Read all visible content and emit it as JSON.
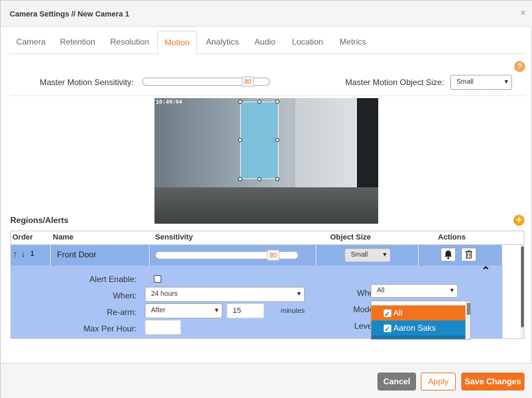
{
  "window": {
    "title": "Camera Settings // New Camera 1",
    "close_glyph": "×"
  },
  "tabs": [
    {
      "label": "Camera",
      "active": false
    },
    {
      "label": "Retention",
      "active": false
    },
    {
      "label": "Resolution",
      "active": false
    },
    {
      "label": "Motion",
      "active": true
    },
    {
      "label": "Analytics",
      "active": false
    },
    {
      "label": "Audio",
      "active": false
    },
    {
      "label": "Location",
      "active": false
    },
    {
      "label": "Metrics",
      "active": false
    }
  ],
  "help_glyph": "?",
  "master": {
    "sensitivity_label": "Master Motion Sensitivity:",
    "sensitivity_value": "80",
    "object_size_label": "Master Motion Object Size:",
    "object_size_value": "Small"
  },
  "preview": {
    "timestamp": "10:49:04"
  },
  "regions": {
    "title": "Regions/Alerts",
    "add_glyph": "+",
    "columns": [
      "Order",
      "Name",
      "Sensitivity",
      "Object Size",
      "Actions"
    ],
    "row": {
      "order_up": "↑",
      "order_down": "↓",
      "order": "1",
      "name": "Front Door",
      "sensitivity": "80",
      "object_size": "Small"
    },
    "detail": {
      "alert_enable_label": "Alert Enable:",
      "when_label": "When:",
      "when_value": "24 hours",
      "rearm_label": "Re-arm:",
      "rearm_value": "After",
      "rearm_minutes": "15",
      "minutes_label": "minutes",
      "max_per_hour_label": "Max Per Hour:",
      "max_per_hour_value": "",
      "who_label": "Who:",
      "who_value": "All",
      "mode_label": "Mode:",
      "level_label": "Level:",
      "collapse_glyph": "⌃"
    }
  },
  "who_dropdown": {
    "options": [
      {
        "label": "All",
        "checked": true,
        "color": "#f0731f"
      },
      {
        "label": "Aaron Saks",
        "checked": true,
        "color": "#1a88c7"
      }
    ]
  },
  "footer": {
    "cancel": "Cancel",
    "apply": "Apply",
    "save": "Save Changes"
  },
  "colors": {
    "accent": "#e8732a",
    "cancel_bg": "#7b7b7b",
    "row_selected": "#8cb0ea",
    "detail_bg": "#a9c4f4"
  }
}
